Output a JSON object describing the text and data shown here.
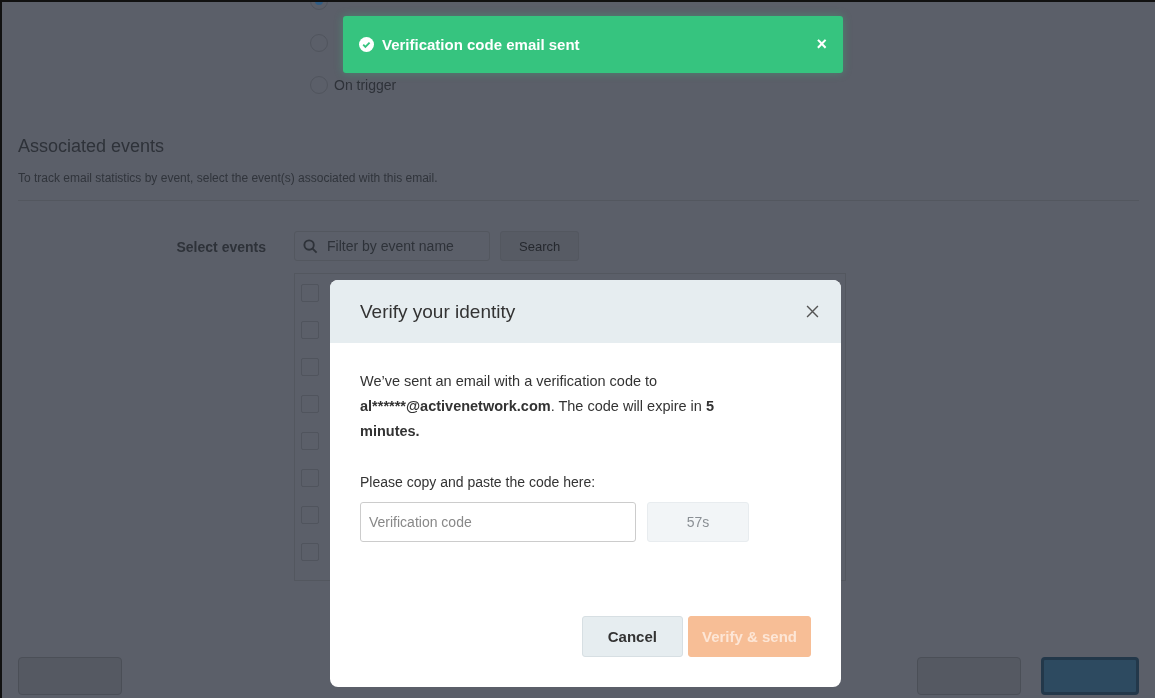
{
  "schedule": {
    "options": [
      {
        "selected": true
      },
      {
        "selected": false
      },
      {
        "label": "On trigger",
        "selected": false
      }
    ]
  },
  "associated_events": {
    "title": "Associated events",
    "description": "To track email statistics by event, select the event(s) associated with this email.",
    "select_label": "Select events",
    "filter_placeholder": "Filter by event name",
    "search_button": "Search",
    "event_rows": [
      {
        "checked": false
      },
      {
        "checked": false
      },
      {
        "checked": false
      },
      {
        "checked": false
      },
      {
        "checked": false
      },
      {
        "checked": false
      },
      {
        "checked": false
      },
      {
        "checked": false
      }
    ]
  },
  "footer": {
    "buttons": [
      {
        "kind": "secondary"
      },
      {
        "kind": "secondary"
      },
      {
        "kind": "primary"
      }
    ]
  },
  "toast": {
    "message": "Verification code email sent",
    "close": "×"
  },
  "modal": {
    "title": "Verify your identity",
    "message": [
      {
        "text": "We’ve sent an email with a verification code to ",
        "bold": false
      },
      {
        "text": "al******@activenetwork.com",
        "bold": true
      },
      {
        "text": ". The code will expire in ",
        "bold": false
      },
      {
        "text": "5 minutes.",
        "bold": true
      }
    ],
    "prompt": "Please copy and paste the code here:",
    "code_placeholder": "Verification code",
    "resend_timer": "57s",
    "cancel": "Cancel",
    "verify": "Verify & send"
  }
}
